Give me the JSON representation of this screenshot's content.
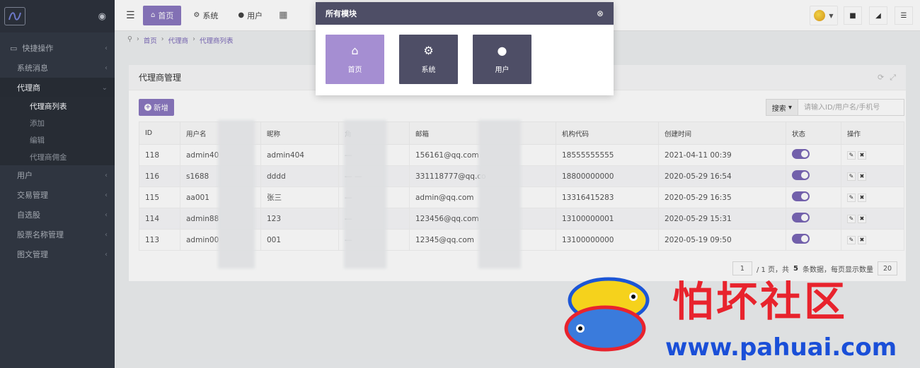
{
  "sidebar": {
    "items": [
      {
        "label": "快捷操作"
      },
      {
        "label": "系统消息"
      },
      {
        "label": "代理商"
      },
      {
        "label": "用户"
      },
      {
        "label": "交易管理"
      },
      {
        "label": "自选股"
      },
      {
        "label": "股票名称管理"
      },
      {
        "label": "图文管理"
      }
    ],
    "sub_items": [
      {
        "label": "代理商列表"
      },
      {
        "label": "添加"
      },
      {
        "label": "编辑"
      },
      {
        "label": "代理商佣金"
      }
    ]
  },
  "topbar": {
    "tabs": [
      {
        "label": "首页",
        "icon": "home-icon"
      },
      {
        "label": "系统",
        "icon": "gear-icon"
      },
      {
        "label": "用户",
        "icon": "user-icon"
      }
    ]
  },
  "breadcrumb": {
    "items": [
      "首页",
      "代理商",
      "代理商列表"
    ]
  },
  "panel": {
    "title": "代理商管理",
    "add_label": "新增",
    "search_label": "搜索",
    "search_placeholder": "请输入ID/用户名/手机号"
  },
  "table": {
    "headers": [
      "ID",
      "用户名",
      "昵称",
      "角",
      "邮箱",
      "机构代码",
      "创建时间",
      "状态",
      "操作"
    ],
    "rows": [
      {
        "id": "118",
        "username": "admin40",
        "nickname": "admin404",
        "role": "—",
        "email": "156161@qq.com",
        "code": "18555555555",
        "created": "2021-04-11 00:39"
      },
      {
        "id": "116",
        "username": "s1688",
        "nickname": "dddd",
        "role": "— —",
        "email": "331118777@qq.co",
        "code": "18800000000",
        "created": "2020-05-29 16:54"
      },
      {
        "id": "115",
        "username": "aa001",
        "nickname": "张三",
        "role": "—",
        "email": "admin@qq.com",
        "code": "13316415283",
        "created": "2020-05-29 16:35"
      },
      {
        "id": "114",
        "username": "admin88",
        "nickname": "123",
        "role": "—",
        "email": "123456@qq.com",
        "code": "13100000001",
        "created": "2020-05-29 15:31"
      },
      {
        "id": "113",
        "username": "admin00",
        "nickname": "001",
        "role": "—",
        "email": "12345@qq.com",
        "code": "13100000000",
        "created": "2020-05-19 09:50"
      }
    ]
  },
  "pager": {
    "page": "1",
    "text_pre": "/ 1 页，共",
    "total": "5",
    "text_post": "条数据，每页显示数量",
    "per_page": "20"
  },
  "modal": {
    "title": "所有模块",
    "tiles": [
      {
        "label": "首页",
        "icon": "home-icon"
      },
      {
        "label": "系统",
        "icon": "gear-icon"
      },
      {
        "label": "用户",
        "icon": "user-icon"
      }
    ]
  },
  "watermark": {
    "title": "怕坏社区",
    "url": "www.pahuai.com"
  },
  "colors": {
    "accent": "#8b78c0",
    "sidebar": "#2f3540",
    "modal_header": "#4e4e66",
    "watermark_red": "#e8232d",
    "watermark_blue": "#1a4fd8"
  }
}
